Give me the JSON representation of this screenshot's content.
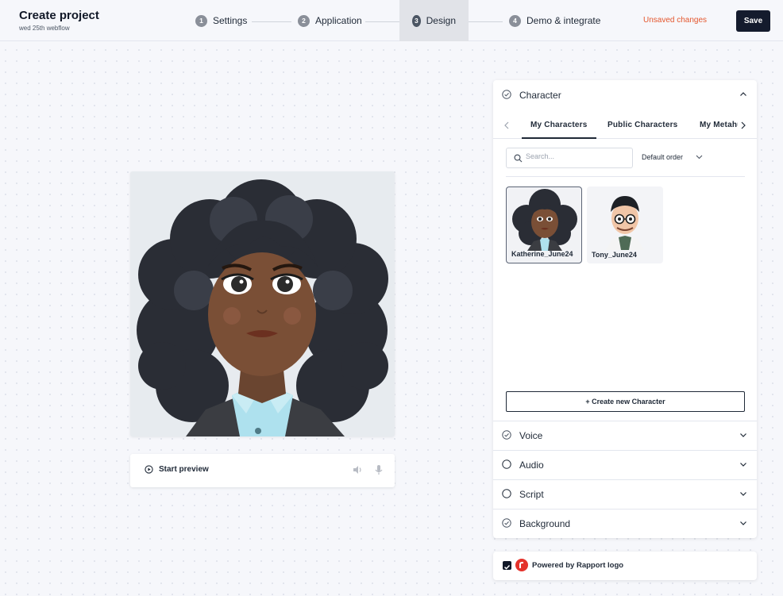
{
  "header": {
    "title": "Create project",
    "subtitle": "wed 25th webflow",
    "steps": [
      {
        "num": "1",
        "label": "Settings"
      },
      {
        "num": "2",
        "label": "Application"
      },
      {
        "num": "3",
        "label": "Design"
      },
      {
        "num": "4",
        "label": "Demo & integrate"
      }
    ],
    "active_step": "Design",
    "unsaved": "Unsaved changes",
    "save_label": "Save"
  },
  "preview": {
    "start_label": "Start preview"
  },
  "panel": {
    "character": {
      "label": "Character",
      "tabs": [
        "My Characters",
        "Public Characters",
        "My Metahumans"
      ],
      "search_placeholder": "Search...",
      "sort_label": "Default order",
      "items": [
        {
          "name": "Katherine_June24",
          "selected": true
        },
        {
          "name": "Tony_June24",
          "selected": false
        }
      ],
      "create_label": "+ Create new Character"
    },
    "sections": [
      {
        "label": "Voice",
        "checked": true
      },
      {
        "label": "Audio",
        "checked": false
      },
      {
        "label": "Script",
        "checked": false
      },
      {
        "label": "Background",
        "checked": true
      }
    ]
  },
  "footer": {
    "powered_label": "Powered by Rapport logo",
    "checked": true
  },
  "colors": {
    "accent": "#141b2d",
    "warning": "#e4572e",
    "brand_logo": "#e4322b"
  }
}
